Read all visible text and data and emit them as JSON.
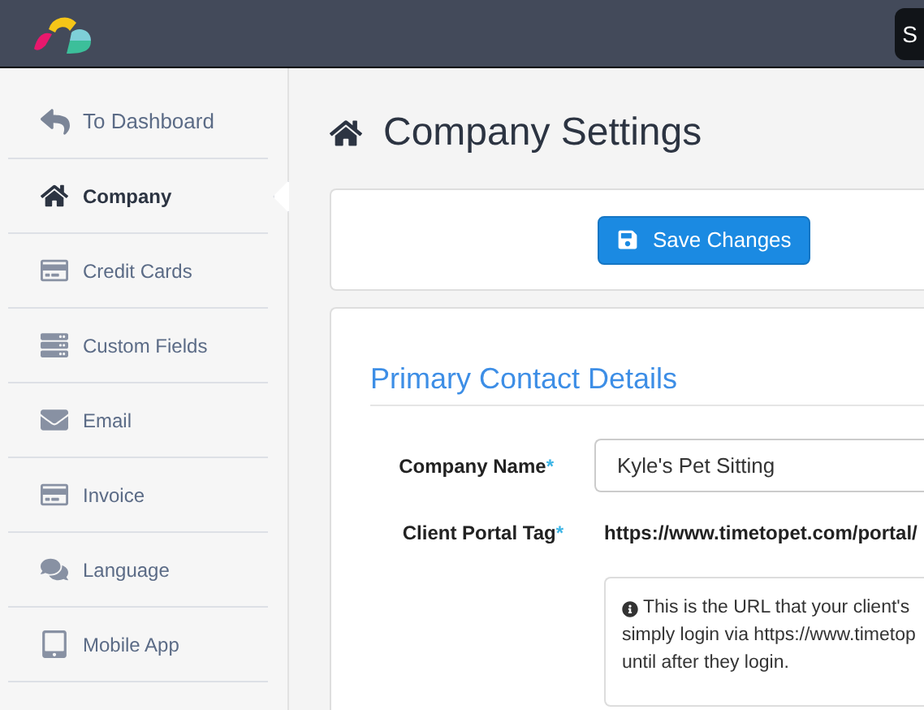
{
  "header": {
    "user_button": "S"
  },
  "sidebar": {
    "back_link": "To Dashboard",
    "items": [
      {
        "label": "Company",
        "selected": true
      },
      {
        "label": "Credit Cards",
        "selected": false
      },
      {
        "label": "Custom Fields",
        "selected": false
      },
      {
        "label": "Email",
        "selected": false
      },
      {
        "label": "Invoice",
        "selected": false
      },
      {
        "label": "Language",
        "selected": false
      },
      {
        "label": "Mobile App",
        "selected": false
      }
    ]
  },
  "page": {
    "title": "Company Settings",
    "save_button": "Save Changes"
  },
  "section": {
    "title": "Primary Contact Details",
    "company_name": {
      "label": "Company Name",
      "required_mark": "*",
      "value": "Kyle's Pet Sitting"
    },
    "portal_tag": {
      "label": "Client Portal Tag",
      "required_mark": "*",
      "prefix": "https://www.timetopet.com/portal/"
    },
    "info_lines": [
      "This is the URL that your client's",
      "simply login via https://www.timetop",
      "until after they login."
    ]
  }
}
